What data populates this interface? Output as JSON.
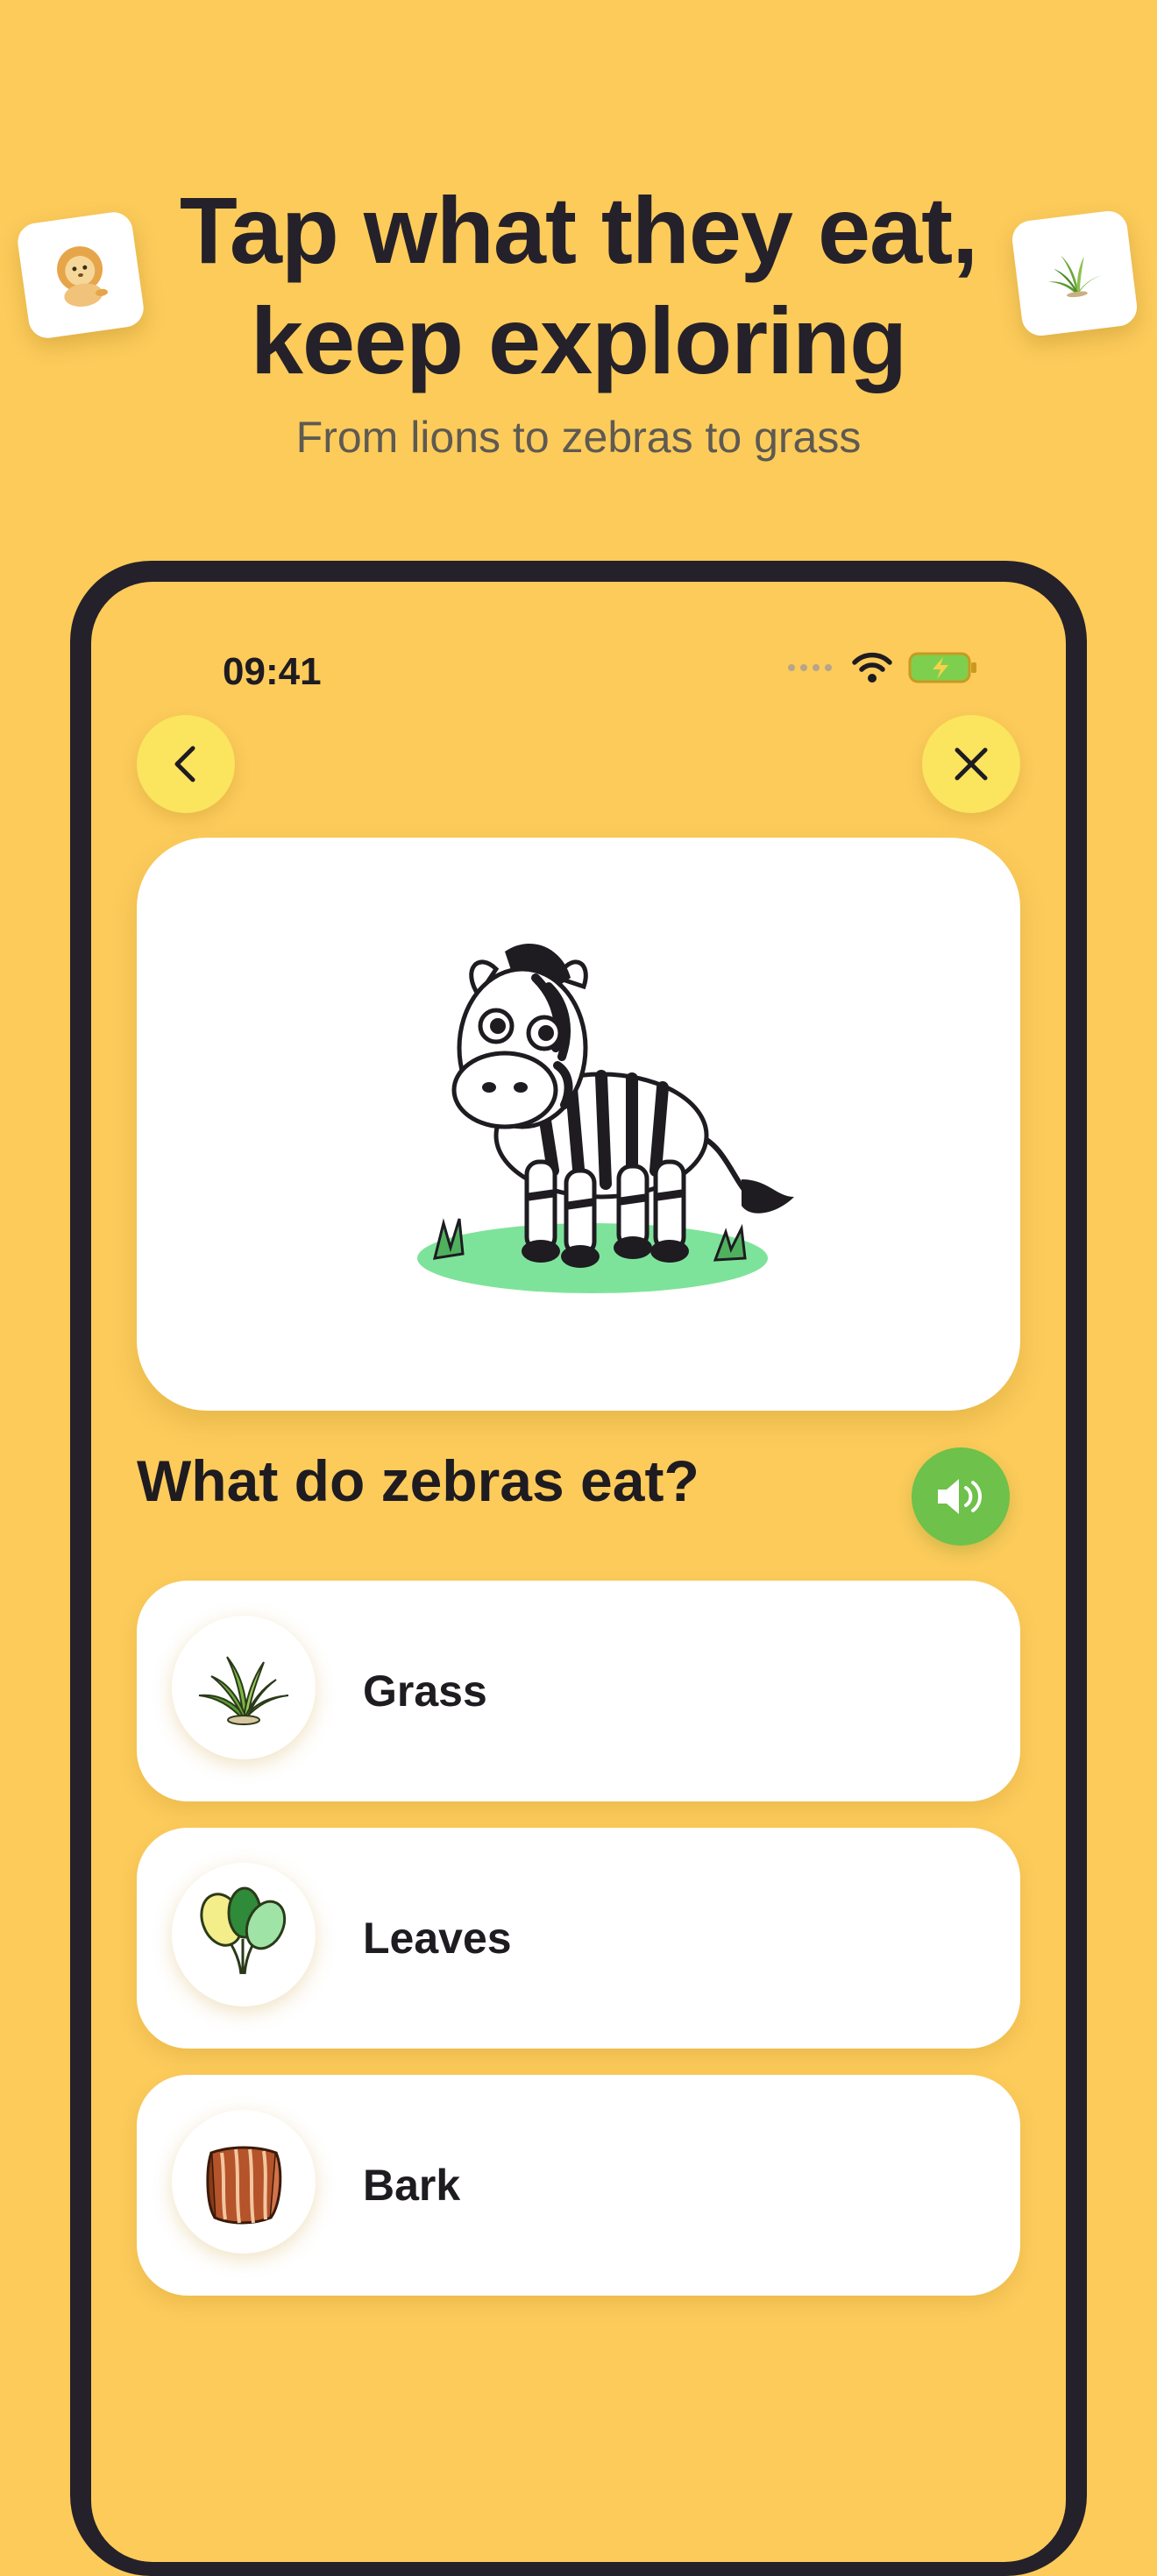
{
  "promo": {
    "headline_line1": "Tap what they eat,",
    "headline_line2": "keep exploring",
    "subtitle": "From lions to zebras to grass",
    "left_sticker_icon": "lion-icon",
    "right_sticker_icon": "grass-icon"
  },
  "status_bar": {
    "time": "09:41",
    "icons": [
      "signal-dots-icon",
      "wifi-icon",
      "battery-charging-icon"
    ]
  },
  "nav": {
    "back_icon": "chevron-left-icon",
    "close_icon": "close-icon"
  },
  "quiz": {
    "image_icon": "zebra-illustration",
    "question": "What do zebras eat?",
    "sound_icon": "speaker-icon",
    "options": [
      {
        "label": "Grass",
        "icon": "grass-icon"
      },
      {
        "label": "Leaves",
        "icon": "leaves-icon"
      },
      {
        "label": "Bark",
        "icon": "bark-icon"
      }
    ]
  },
  "colors": {
    "background": "#FCCB5A",
    "phone_frame": "#25212A",
    "nav_button": "#FBE45E",
    "sound_button": "#6EC14A",
    "card": "#FFFFFF"
  }
}
